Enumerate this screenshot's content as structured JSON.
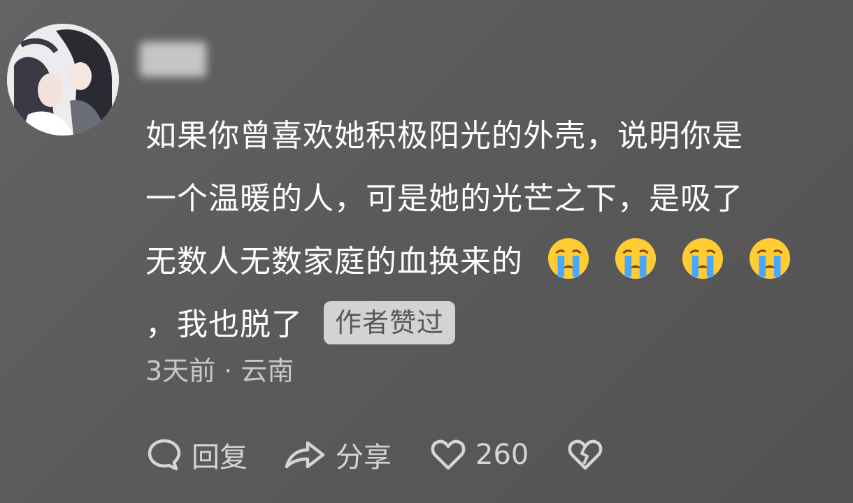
{
  "comment": {
    "lines": [
      "如果你曾喜欢她积极阳光的外壳，说明你是",
      "一个温暖的人，可是她的光芒之下，是吸了",
      "无数人无数家庭的血换来的",
      "，我也脱了"
    ],
    "emojis": [
      "crying-face-icon",
      "crying-face-icon",
      "crying-face-icon",
      "crying-face-icon"
    ],
    "author_liked_badge": "作者赞过"
  },
  "meta": {
    "time_location": "3天前 · 云南"
  },
  "actions": {
    "reply_label": "回复",
    "share_label": "分享",
    "like_count": "260"
  },
  "icons": {
    "reply": "comment-bubble-icon",
    "share": "share-arrow-icon",
    "like": "heart-icon",
    "dislike": "broken-heart-icon"
  }
}
